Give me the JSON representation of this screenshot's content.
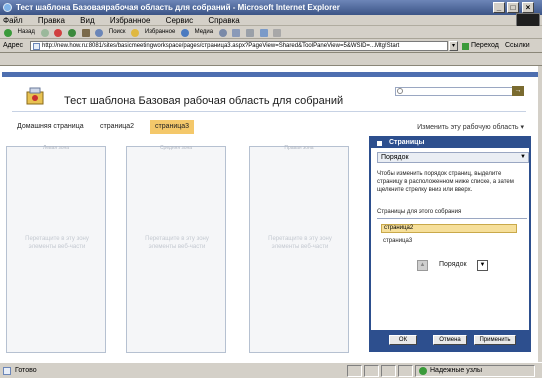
{
  "window": {
    "title": "Тест шаблона Базоваярабочая область для собраний - Microsoft Internet Explorer",
    "min_icon": "minimize-icon",
    "max_icon": "maximize-icon",
    "close_icon": "close-icon"
  },
  "menu": [
    "Файл",
    "Правка",
    "Вид",
    "Избранное",
    "Сервис",
    "Справка"
  ],
  "toolbar": {
    "back": "Назад",
    "search": "Поиск",
    "favorites": "Избранное",
    "media": "Медиа"
  },
  "address": {
    "label": "Адрес",
    "url": "http://new.how.ru:8081/sites/basicmeetingworkspace/pages/страница3.aspx?PageView=Shared&ToolPaneView=5&WSID=...Mtg!Start",
    "go": "Переход",
    "links": "Ссылки"
  },
  "page": {
    "title": "Тест шаблона Базовая рабочая область для собраний",
    "edit_link": "Изменить эту рабочую область ▾",
    "tabs": [
      {
        "label": "Домашняя страница",
        "active": false
      },
      {
        "label": "страница2",
        "active": false
      },
      {
        "label": "страница3",
        "active": true
      }
    ],
    "zones": [
      {
        "header": "Левая зона",
        "body": "Перетащите в эту зону элементы веб-части"
      },
      {
        "header": "Средняя зона",
        "body": "Перетащите в эту зону элементы веб-части"
      },
      {
        "header": "Правая зона",
        "body": "Перетащите в эту зону элементы веб-части"
      }
    ]
  },
  "panel": {
    "title": "Страницы",
    "dropdown": "Порядок",
    "description": "Чтобы изменить порядок страниц, выделите страницу в расположенном ниже списке, а затем щелкните стрелку вниз или вверх.",
    "pages_label": "Страницы для этого собрания",
    "pages": [
      "страница2",
      "страница3"
    ],
    "order_label": "Порядок",
    "buttons": {
      "ok": "ОК",
      "cancel": "Отмена",
      "apply": "Применить"
    }
  },
  "status": {
    "left": "Готово",
    "zone": "Надежные узлы"
  },
  "colors": {
    "accent": "#2d4f8e",
    "active_tab": "#f4c86a"
  }
}
